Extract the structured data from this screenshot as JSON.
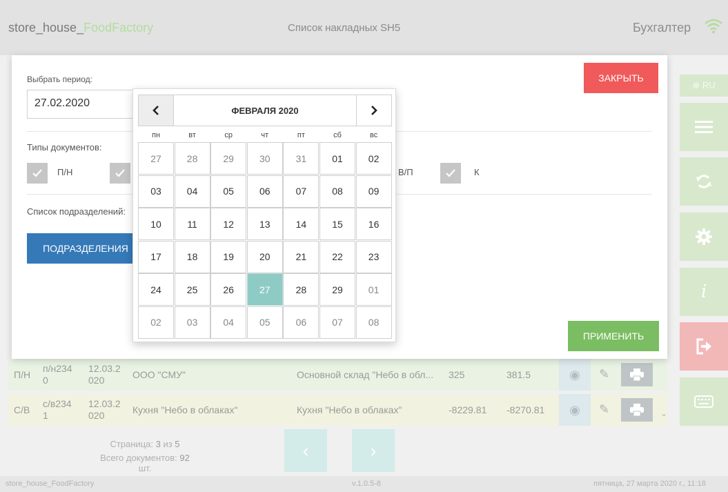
{
  "header": {
    "app_title_main": "store_house_",
    "app_title_accent": "FoodFactory",
    "page_title": "Список накладных SH5",
    "user_role": "Бухгалтер"
  },
  "side_menu": {
    "lang_label": "⊕ RU"
  },
  "dialog": {
    "period_label": "Выбрать период:",
    "date_value": "27.02.2020",
    "close_label": "ЗАКРЫТЬ",
    "doc_types_label": "Типы документов:",
    "doc_types": [
      {
        "label": "П/Н",
        "checked": true
      },
      {
        "label": "",
        "checked": true
      },
      {
        "label": "В/П",
        "checked": true
      },
      {
        "label": "К",
        "checked": true
      }
    ],
    "dept_list_label": "Список подразделений:",
    "dept_button_label": "ПОДРАЗДЕЛЕНИЯ",
    "apply_label": "ПРИМЕНИТЬ"
  },
  "calendar": {
    "month_label": "ФЕВРАЛЯ 2020",
    "prev_icon": "‹",
    "next_icon": "›",
    "weekdays": [
      "пн",
      "вт",
      "ср",
      "чт",
      "пт",
      "сб",
      "вс"
    ],
    "weeks": [
      [
        "27",
        "28",
        "29",
        "30",
        "31",
        "01",
        "02"
      ],
      [
        "03",
        "04",
        "05",
        "06",
        "07",
        "08",
        "09"
      ],
      [
        "10",
        "11",
        "12",
        "13",
        "14",
        "15",
        "16"
      ],
      [
        "17",
        "18",
        "19",
        "20",
        "21",
        "22",
        "23"
      ],
      [
        "24",
        "25",
        "26",
        "27",
        "28",
        "29",
        "01"
      ],
      [
        "02",
        "03",
        "04",
        "05",
        "06",
        "07",
        "08"
      ]
    ],
    "selected_day": "27",
    "colors": {
      "selected": "#8fcbc5"
    }
  },
  "table": {
    "rows": [
      {
        "type": "П/Н",
        "number_a": "п/н234",
        "number_b": "0",
        "date_a": "12.03.2",
        "date_b": "020",
        "supplier": "ООО \"СМУ\"",
        "warehouse": "Основной склад \"Небо в обл...",
        "sum1": "325",
        "sum2": "381.5"
      },
      {
        "type": "С/В",
        "number_a": "с/в234",
        "number_b": "1",
        "date_a": "12.03.2",
        "date_b": "020",
        "supplier": "Кухня \"Небо в облаках\"",
        "warehouse": "Кухня \"Небо в облаках\"",
        "sum1": "-8229.81",
        "sum2": "-8270.81"
      }
    ]
  },
  "pager": {
    "page_prefix": "Страница: ",
    "page_current": "3",
    "page_sep": " из ",
    "page_total": "5",
    "docs_prefix": "Всего документов: ",
    "docs_count": "92",
    "docs_suffix": " шт."
  },
  "footer": {
    "left": "store_house_FoodFactory",
    "version": "v.1.0.5-8",
    "datetime": "пятница, 27 марта 2020 г., 11:18"
  },
  "colors": {
    "close_red": "#f05a5a",
    "apply_green": "#7bbd62",
    "dept_blue": "#3579b8"
  }
}
